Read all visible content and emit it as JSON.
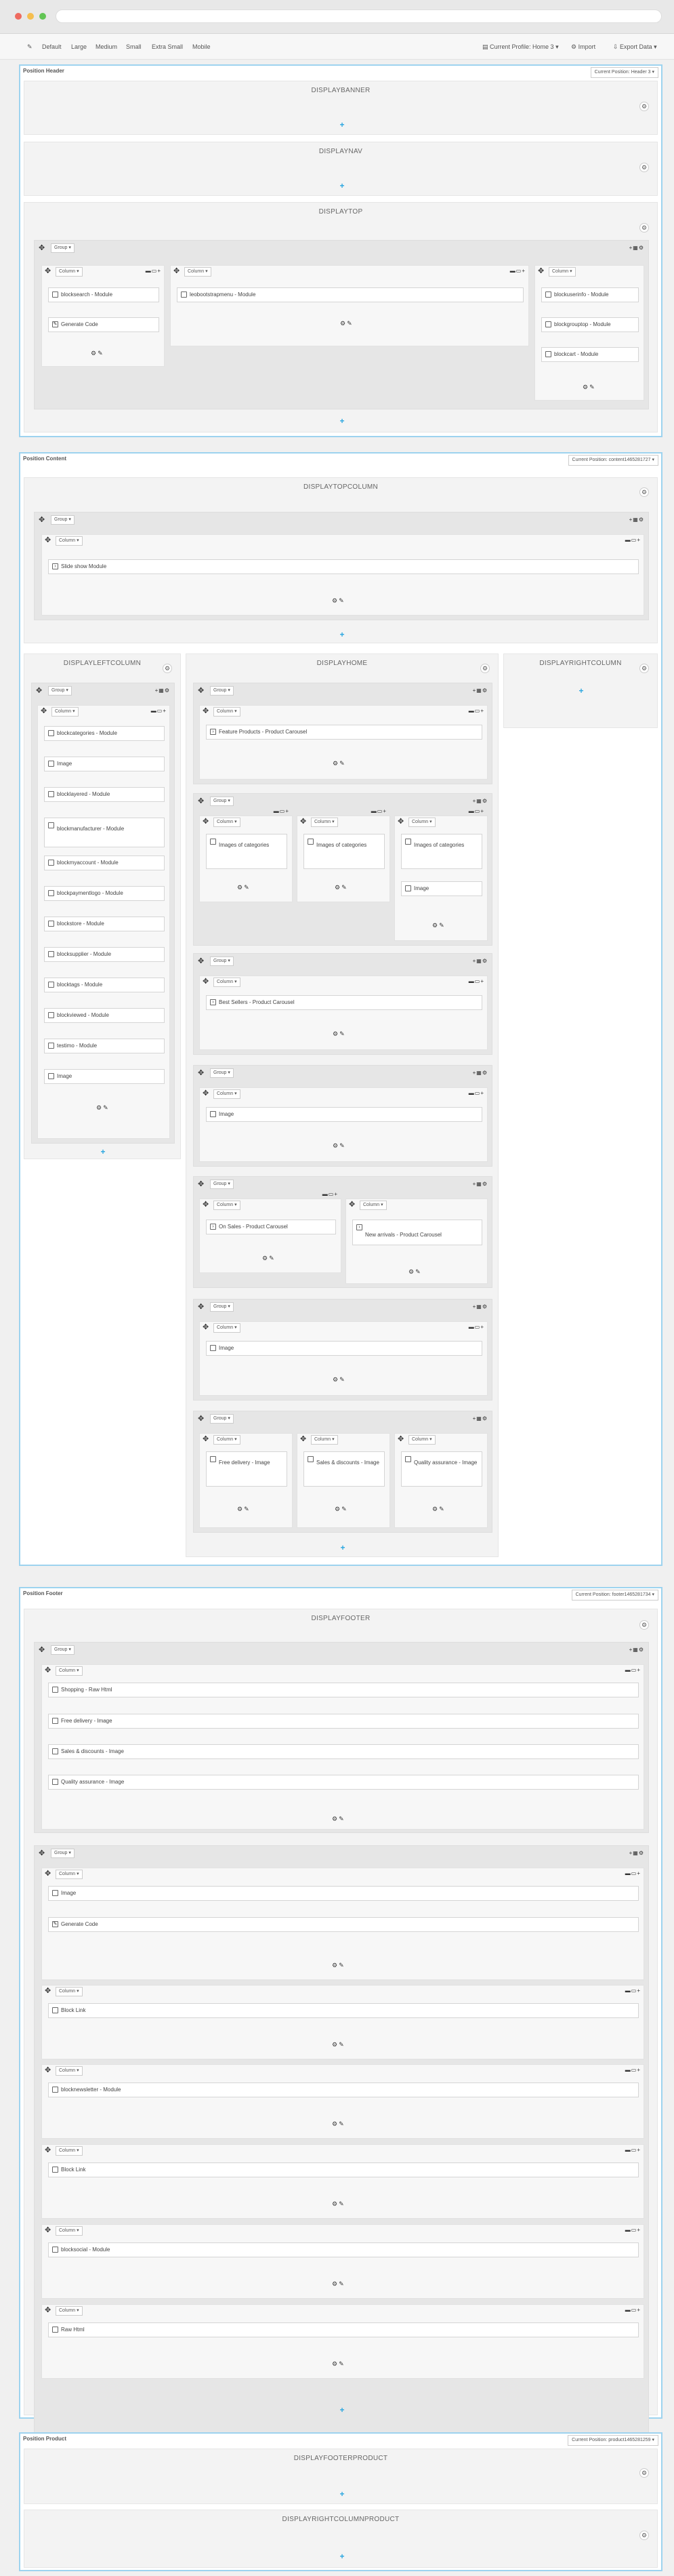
{
  "colors": {
    "accent": "#2aa6e0",
    "frame": "#9dd3ef",
    "hook": "#f3f3f3",
    "group": "#e6e6e6"
  },
  "toolbar": {
    "edit_icon": "pencil-icon",
    "devices": [
      "Default",
      "Large",
      "Medium",
      "Small",
      "Extra Small",
      "Mobile"
    ],
    "profile_label": "Current Profile: Home 3",
    "import_label": "Import",
    "export_label": "Export Data"
  },
  "labels": {
    "group": "Group",
    "column": "Column",
    "add": "+"
  },
  "positions": {
    "header": {
      "title": "Position Header",
      "select": "Current Position: Header 3"
    },
    "content": {
      "title": "Position Content",
      "select": "Current Position: content1465281727"
    },
    "footer": {
      "title": "Position Footer",
      "select": "Current Position: footer1465281734"
    },
    "product": {
      "title": "Position Product",
      "select": "Current Position: product1465281259"
    }
  },
  "hooks": {
    "displaybanner": "DISPLAYBANNER",
    "displaynav": "DISPLAYNAV",
    "displaytop": "DISPLAYTOP",
    "displaytopcolumn": "DISPLAYTOPCOLUMN",
    "displayleftcolumn": "DISPLAYLEFTCOLUMN",
    "displayhome": "DISPLAYHOME",
    "displayrightcolumn": "DISPLAYRIGHTCOLUMN",
    "displayfooter": "DISPLAYFOOTER",
    "displayfooterproduct": "DISPLAYFOOTERPRODUCT",
    "displayrightcolumnproduct": "DISPLAYRIGHTCOLUMNPRODUCT"
  },
  "modules": {
    "top_col1": [
      "blocksearch - Module",
      "Generate Code"
    ],
    "top_col2": [
      "leobootstrapmenu - Module"
    ],
    "top_col3": [
      "blockuserinfo - Module",
      "blockgrouptop - Module",
      "blockcart - Module"
    ],
    "topcolumn": [
      "Slide show Module"
    ],
    "left": [
      "blockcategories - Module",
      "Image",
      "blocklayered - Module",
      "blockmanufacturer - Module",
      "blockmyaccount - Module",
      "blockpaymentlogo - Module",
      "blockstore - Module",
      "blocksupplier - Module",
      "blocktags - Module",
      "blockviewed - Module",
      "testimo - Module",
      "Image"
    ],
    "home_featured": "Feature Products - Product Carousel",
    "home_images_categories": [
      "Images of categories",
      "Images of categories",
      "Images of categories"
    ],
    "home_image": "Image",
    "home_best": "Best Sellers - Product Carousel",
    "home_image2": "Image",
    "home_onsales": "On Sales - Product Carousel",
    "home_new": "New arrivals - Product Carousel",
    "home_image3": "Image",
    "home_three": [
      "Free delivery - Image",
      "Sales & discounts - Image",
      "Quality assurance - Image"
    ],
    "footer_g1": [
      "Shopping - Raw Html",
      "Free delivery - Image",
      "Sales & discounts - Image",
      "Quality assurance - Image"
    ],
    "footer_g2": [
      "Image",
      "Generate Code"
    ],
    "footer_c3": "Block Link",
    "footer_c4": "blocknewsletter - Module",
    "footer_c5": "Block Link",
    "footer_c6": "blocksocial - Module",
    "footer_c7": "Raw Html"
  }
}
